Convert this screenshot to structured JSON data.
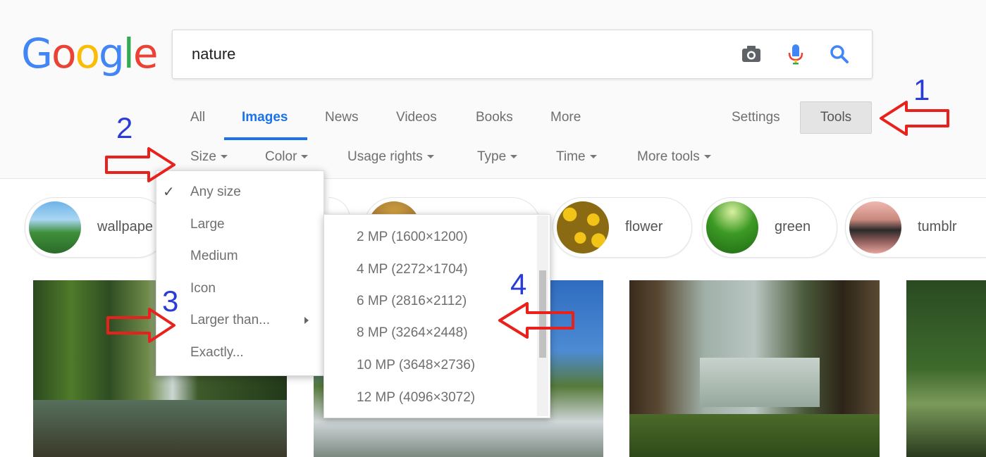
{
  "logo": {
    "letters": [
      "G",
      "o",
      "o",
      "g",
      "l",
      "e"
    ],
    "colors": [
      "#4285F4",
      "#EA4335",
      "#FBBC05",
      "#4285F4",
      "#34A853",
      "#EA4335"
    ]
  },
  "search": {
    "value": "nature",
    "icons": [
      "camera-icon",
      "microphone-icon",
      "search-icon"
    ]
  },
  "tabs": [
    {
      "label": "All",
      "active": false
    },
    {
      "label": "Images",
      "active": true
    },
    {
      "label": "News",
      "active": false
    },
    {
      "label": "Videos",
      "active": false
    },
    {
      "label": "Books",
      "active": false
    },
    {
      "label": "More",
      "active": false
    }
  ],
  "settings_label": "Settings",
  "tools_label": "Tools",
  "filters": [
    "Size",
    "Color",
    "Usage rights",
    "Type",
    "Time",
    "More tools"
  ],
  "chips": [
    {
      "label": "wallpape"
    },
    {
      "label": "flower"
    },
    {
      "label": "green"
    },
    {
      "label": "tumblr"
    }
  ],
  "size_menu": {
    "items": [
      "Any size",
      "Large",
      "Medium",
      "Icon",
      "Larger than...",
      "Exactly..."
    ],
    "selected": "Any size"
  },
  "larger_than_menu": {
    "items": [
      "2 MP (1600×1200)",
      "4 MP (2272×1704)",
      "6 MP (2816×2112)",
      "8 MP (3264×2448)",
      "10 MP (3648×2736)",
      "12 MP (4096×3072)"
    ]
  },
  "annotations": {
    "numbers": [
      "1",
      "2",
      "3",
      "4"
    ],
    "arrow_color": "#e8211d",
    "number_color": "#2a3bd6"
  }
}
